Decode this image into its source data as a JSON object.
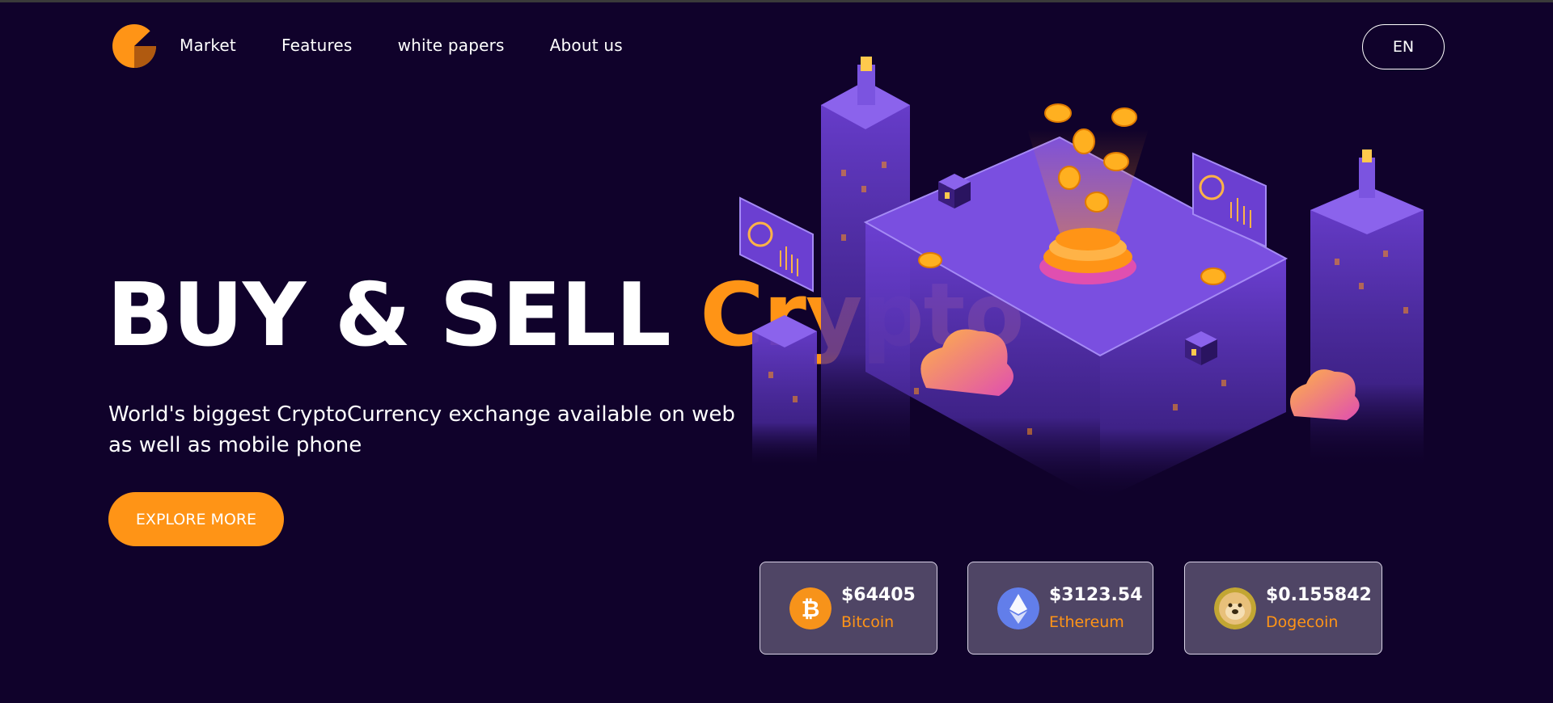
{
  "nav": {
    "links": [
      "Market",
      "Features",
      "white papers",
      "About us"
    ],
    "language": "EN"
  },
  "hero": {
    "headline_main": "BUY & SELL",
    "headline_accent": "Crypto",
    "subtitle": "World's biggest CryptoCurrency exchange available on web as well as mobile phone",
    "cta_label": "EXPLORE MORE"
  },
  "coins": [
    {
      "price": "$64405",
      "name": "Bitcoin",
      "icon": "bitcoin-icon"
    },
    {
      "price": "$3123.54",
      "name": "Ethereum",
      "icon": "ethereum-icon"
    },
    {
      "price": "$0.155842",
      "name": "Dogecoin",
      "icon": "dogecoin-icon"
    }
  ],
  "colors": {
    "background": "#10022b",
    "accent": "#ff9416",
    "card_bg": "#4f4565",
    "illustration_purple": "#6b3fd1"
  }
}
